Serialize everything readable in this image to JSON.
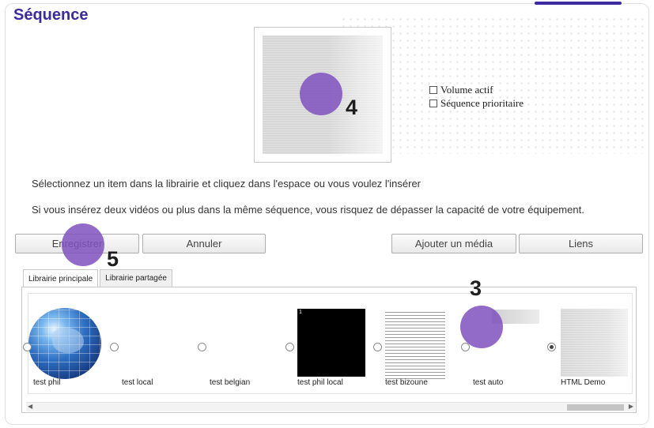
{
  "header": {
    "title": "Séquence"
  },
  "preview": {
    "marker_number": "4"
  },
  "options": {
    "volume_label": "Volume actif",
    "priority_label": "Séquence prioritaire"
  },
  "info": {
    "line1": "Sélectionnez un item dans la librairie et cliquez dans l'espace ou vous voulez l'insérer",
    "line2": "Si vous insérez deux vidéos ou plus dans la même séquence, vous risquez de dépasser la capacité de votre équipement."
  },
  "buttons": {
    "save": "Enregistrer",
    "cancel": "Annuler",
    "add_media": "Ajouter un média",
    "links": "Liens",
    "save_marker_number": "5"
  },
  "tabs": [
    {
      "label": "Librairie principale"
    },
    {
      "label": "Librairie partagée"
    }
  ],
  "library": {
    "marker_number": "3",
    "items": [
      {
        "label": "test phil"
      },
      {
        "label": "test local"
      },
      {
        "label": "test belgian"
      },
      {
        "label": "test phil local"
      },
      {
        "label": "test bizoune"
      },
      {
        "label": "test auto"
      },
      {
        "label": "HTML Demo",
        "selected": true
      }
    ]
  },
  "colors": {
    "accent": "#3b2aa0",
    "marker": "#7f50be"
  }
}
